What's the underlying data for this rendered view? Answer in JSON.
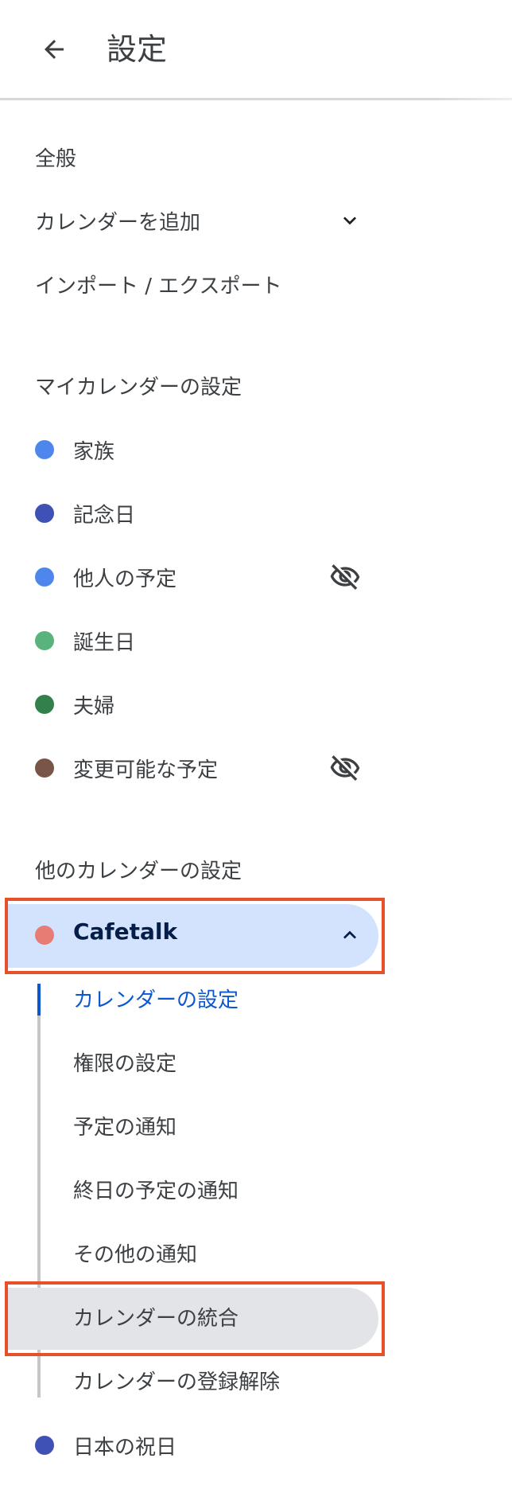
{
  "header": {
    "title": "設定"
  },
  "menu": {
    "general": "全般",
    "add_calendar": "カレンダーを追加",
    "import_export": "インポート / エクスポート"
  },
  "my_calendars": {
    "title": "マイカレンダーの設定",
    "items": [
      {
        "label": "家族",
        "color": "#4f86ec",
        "hidden": false
      },
      {
        "label": "記念日",
        "color": "#3f51b5",
        "hidden": false
      },
      {
        "label": "他人の予定",
        "color": "#4f86ec",
        "hidden": true
      },
      {
        "label": "誕生日",
        "color": "#58b37c",
        "hidden": false
      },
      {
        "label": "夫婦",
        "color": "#33804a",
        "hidden": false
      },
      {
        "label": "変更可能な予定",
        "color": "#795548",
        "hidden": true
      }
    ]
  },
  "other_calendars": {
    "title": "他のカレンダーの設定",
    "selected": {
      "label": "Cafetalk",
      "color": "#e67c73"
    },
    "sub_items": [
      "カレンダーの設定",
      "権限の設定",
      "予定の通知",
      "終日の予定の通知",
      "その他の通知",
      "カレンダーの統合",
      "カレンダーの登録解除"
    ],
    "next": {
      "label": "日本の祝日",
      "color": "#3f51b5"
    }
  }
}
